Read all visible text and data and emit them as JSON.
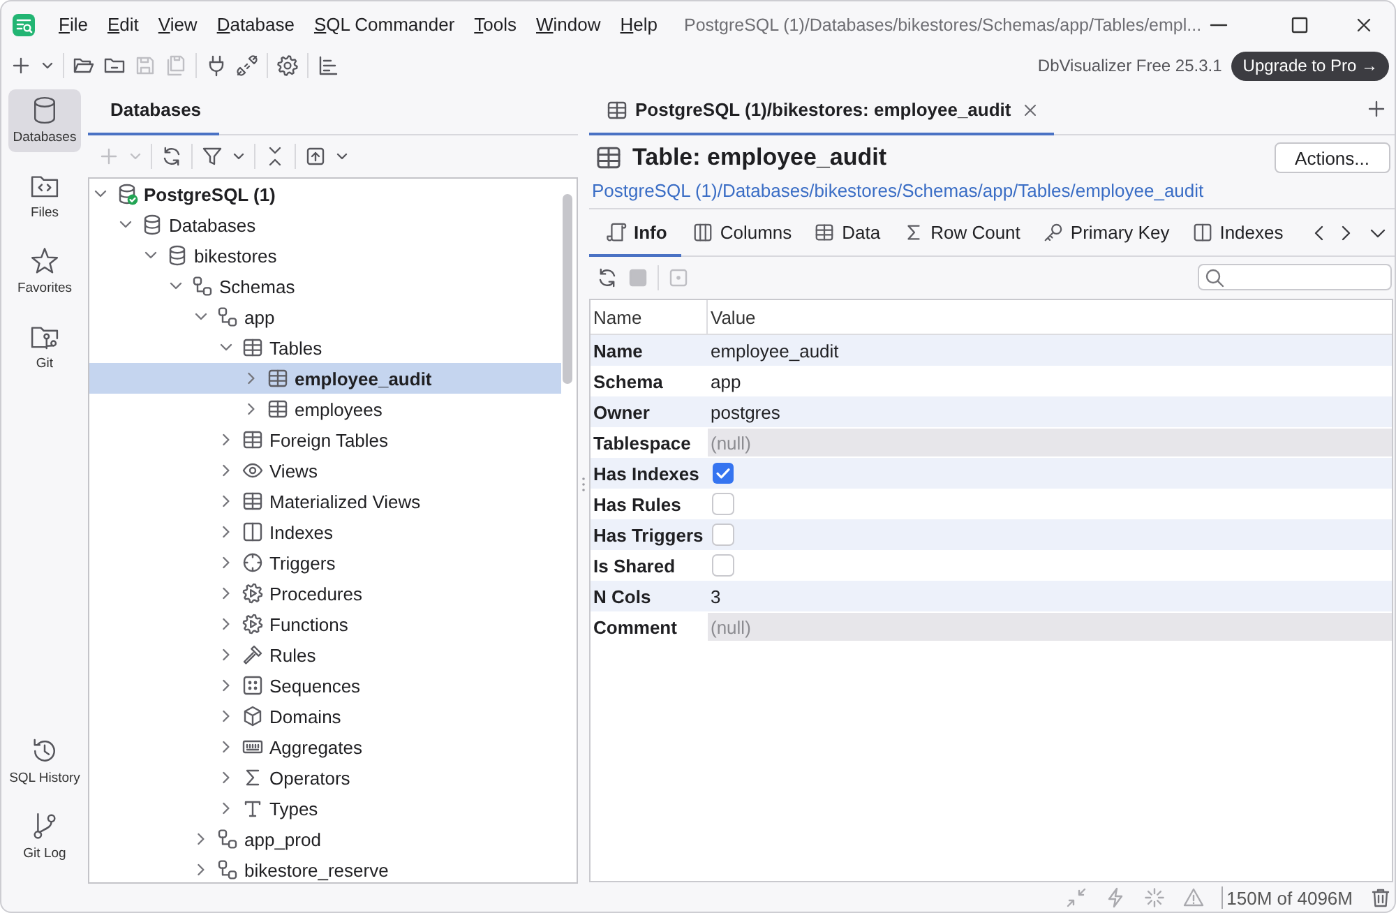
{
  "menu_bar": {
    "items": [
      "File",
      "Edit",
      "View",
      "Database",
      "SQL Commander",
      "Tools",
      "Window",
      "Help"
    ],
    "title": "PostgreSQL (1)/Databases/bikestores/Schemas/app/Tables/empl..."
  },
  "main_toolbar": {
    "groups": [
      [
        {
          "kind": "add",
          "disabled": false
        },
        {
          "kind": "dropdown",
          "disabled": false
        }
      ],
      [
        {
          "kind": "open",
          "disabled": false
        },
        {
          "kind": "folder",
          "disabled": false
        },
        {
          "kind": "save",
          "disabled": true
        },
        {
          "kind": "save_all",
          "disabled": true
        }
      ],
      [
        {
          "kind": "connect",
          "disabled": false
        },
        {
          "kind": "disconnect",
          "disabled": false
        }
      ],
      [
        {
          "kind": "settings",
          "disabled": false
        }
      ],
      [
        {
          "kind": "chart",
          "disabled": false
        }
      ]
    ],
    "edition": "DbVisualizer Free 25.3.1",
    "upgrade_button": "Upgrade to Pro →"
  },
  "rail": {
    "top": [
      {
        "label": "Databases",
        "kind": "databases",
        "selected": true
      },
      {
        "label": "Files",
        "kind": "files",
        "selected": false
      },
      {
        "label": "Favorites",
        "kind": "favorites",
        "selected": false
      },
      {
        "label": "Git",
        "kind": "git",
        "selected": false
      }
    ],
    "bottom": [
      {
        "label": "SQL History",
        "kind": "history",
        "selected": false
      },
      {
        "label": "Git Log",
        "kind": "gitlog",
        "selected": false
      }
    ]
  },
  "databases_panel": {
    "tabs": [
      {
        "label": "Databases",
        "selected": true
      }
    ],
    "toolbar": {
      "groups": [
        [
          {
            "kind": "add",
            "disabled": true
          },
          {
            "kind": "dropdown",
            "disabled": true
          }
        ],
        [
          {
            "kind": "refresh",
            "disabled": false
          }
        ],
        [
          {
            "kind": "filter",
            "disabled": false
          },
          {
            "kind": "dropdown",
            "disabled": false
          }
        ],
        [
          {
            "kind": "collapse",
            "disabled": false
          }
        ],
        [
          {
            "kind": "export",
            "disabled": false
          },
          {
            "kind": "dropdown",
            "disabled": false
          }
        ]
      ]
    },
    "tree": [
      {
        "label": "PostgreSQL (1)",
        "kind": "connection",
        "connected": true,
        "expanded": true,
        "selected": false,
        "children": [
          {
            "label": "Databases",
            "kind": "database",
            "expanded": true,
            "selected": false,
            "children": [
              {
                "label": "bikestores",
                "kind": "database",
                "expanded": true,
                "selected": false,
                "children": [
                  {
                    "label": "Schemas",
                    "kind": "schema",
                    "expanded": true,
                    "selected": false,
                    "children": [
                      {
                        "label": "app",
                        "kind": "schema",
                        "expanded": true,
                        "selected": false,
                        "children": [
                          {
                            "label": "Tables",
                            "kind": "table",
                            "expanded": true,
                            "selected": false,
                            "children": [
                              {
                                "label": "employee_audit",
                                "kind": "table",
                                "expanded": false,
                                "selected": true
                              },
                              {
                                "label": "employees",
                                "kind": "table",
                                "expanded": false,
                                "selected": false
                              }
                            ]
                          },
                          {
                            "label": "Foreign Tables",
                            "kind": "table",
                            "expanded": false,
                            "selected": false
                          },
                          {
                            "label": "Views",
                            "kind": "view",
                            "expanded": false,
                            "selected": false
                          },
                          {
                            "label": "Materialized Views",
                            "kind": "table",
                            "expanded": false,
                            "selected": false
                          },
                          {
                            "label": "Indexes",
                            "kind": "index",
                            "expanded": false,
                            "selected": false
                          },
                          {
                            "label": "Triggers",
                            "kind": "trigger",
                            "expanded": false,
                            "selected": false
                          },
                          {
                            "label": "Procedures",
                            "kind": "procedure",
                            "expanded": false,
                            "selected": false
                          },
                          {
                            "label": "Functions",
                            "kind": "function",
                            "expanded": false,
                            "selected": false
                          },
                          {
                            "label": "Rules",
                            "kind": "rule",
                            "expanded": false,
                            "selected": false
                          },
                          {
                            "label": "Sequences",
                            "kind": "sequence",
                            "expanded": false,
                            "selected": false
                          },
                          {
                            "label": "Domains",
                            "kind": "domain",
                            "expanded": false,
                            "selected": false
                          },
                          {
                            "label": "Aggregates",
                            "kind": "aggregate",
                            "expanded": false,
                            "selected": false
                          },
                          {
                            "label": "Operators",
                            "kind": "operator",
                            "expanded": false,
                            "selected": false
                          },
                          {
                            "label": "Types",
                            "kind": "type",
                            "expanded": false,
                            "selected": false
                          }
                        ]
                      },
                      {
                        "label": "app_prod",
                        "kind": "schema",
                        "expanded": false,
                        "selected": false
                      },
                      {
                        "label": "bikestore_reserve",
                        "kind": "schema",
                        "expanded": false,
                        "selected": false
                      }
                    ]
                  }
                ]
              }
            ]
          }
        ]
      }
    ]
  },
  "editor_tabs": [
    {
      "label": "PostgreSQL (1)/bikestores: employee_audit",
      "kind": "table",
      "selected": true
    }
  ],
  "object_view": {
    "title": "Table: employee_audit",
    "actions_button": "Actions...",
    "path": "PostgreSQL (1)/Databases/bikestores/Schemas/app/Tables/employee_audit",
    "tabs": [
      {
        "label": "Info",
        "kind": "info",
        "selected": true
      },
      {
        "label": "Columns",
        "kind": "columns",
        "selected": false
      },
      {
        "label": "Data",
        "kind": "data",
        "selected": false
      },
      {
        "label": "Row Count",
        "kind": "rowcount",
        "selected": false
      },
      {
        "label": "Primary Key",
        "kind": "key",
        "selected": false
      },
      {
        "label": "Indexes",
        "kind": "indexes",
        "selected": false
      }
    ],
    "toolbar": {
      "groups": [
        [
          {
            "kind": "refresh",
            "disabled": false
          },
          {
            "kind": "stop",
            "disabled": true
          }
        ],
        [
          {
            "kind": "details",
            "disabled": true
          }
        ]
      ]
    },
    "table": {
      "columns": [
        "Name",
        "Value"
      ],
      "rows": [
        {
          "name": "Name",
          "kind": "text",
          "value": "employee_audit"
        },
        {
          "name": "Schema",
          "kind": "text",
          "value": "app"
        },
        {
          "name": "Owner",
          "kind": "text",
          "value": "postgres"
        },
        {
          "name": "Tablespace",
          "kind": "null",
          "value": "(null)"
        },
        {
          "name": "Has Indexes",
          "kind": "checkbox",
          "checked": true
        },
        {
          "name": "Has Rules",
          "kind": "checkbox",
          "checked": false
        },
        {
          "name": "Has Triggers",
          "kind": "checkbox",
          "checked": false
        },
        {
          "name": "Is Shared",
          "kind": "checkbox",
          "checked": false
        },
        {
          "name": "N Cols",
          "kind": "text",
          "value": "3"
        },
        {
          "name": "Comment",
          "kind": "null",
          "value": "(null)"
        }
      ]
    }
  },
  "status_bar": {
    "memory": "150M of 4096M"
  }
}
